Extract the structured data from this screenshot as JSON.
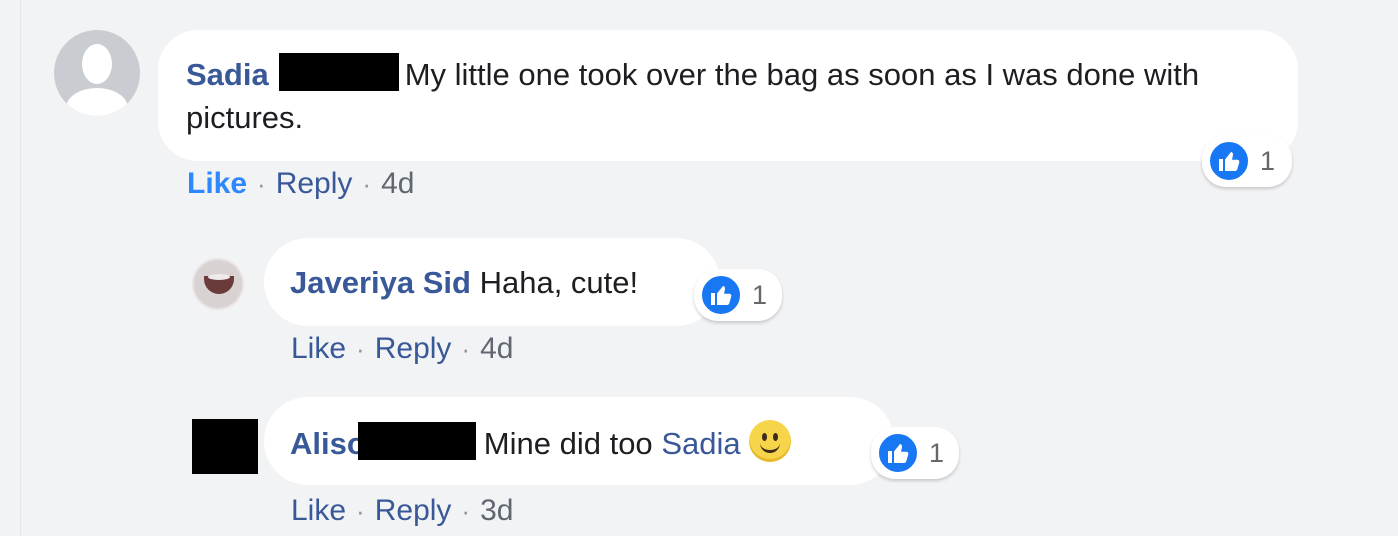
{
  "comments": [
    {
      "author": "Sadia",
      "text": "My little one took over the bag as soon as I was done with pictures.",
      "reaction_count": "1",
      "like_label": "Like",
      "reply_label": "Reply",
      "time": "4d"
    },
    {
      "author": "Javeriya Sid",
      "text": "Haha, cute!",
      "reaction_count": "1",
      "like_label": "Like",
      "reply_label": "Reply",
      "time": "4d"
    },
    {
      "author": "Aliso",
      "text": "Mine did too",
      "mention": "Sadia",
      "reaction_count": "1",
      "like_label": "Like",
      "reply_label": "Reply",
      "time": "3d"
    }
  ],
  "separator": "·",
  "icons": {
    "reaction": "thumbs-up-icon",
    "emoji": "smiley-emoji-icon",
    "avatar_default": "default-avatar-icon"
  },
  "colors": {
    "author": "#385898",
    "liked": "#2d88ff",
    "like_reaction": "#1877f2",
    "background": "#f2f3f5",
    "bubble": "#ffffff"
  }
}
